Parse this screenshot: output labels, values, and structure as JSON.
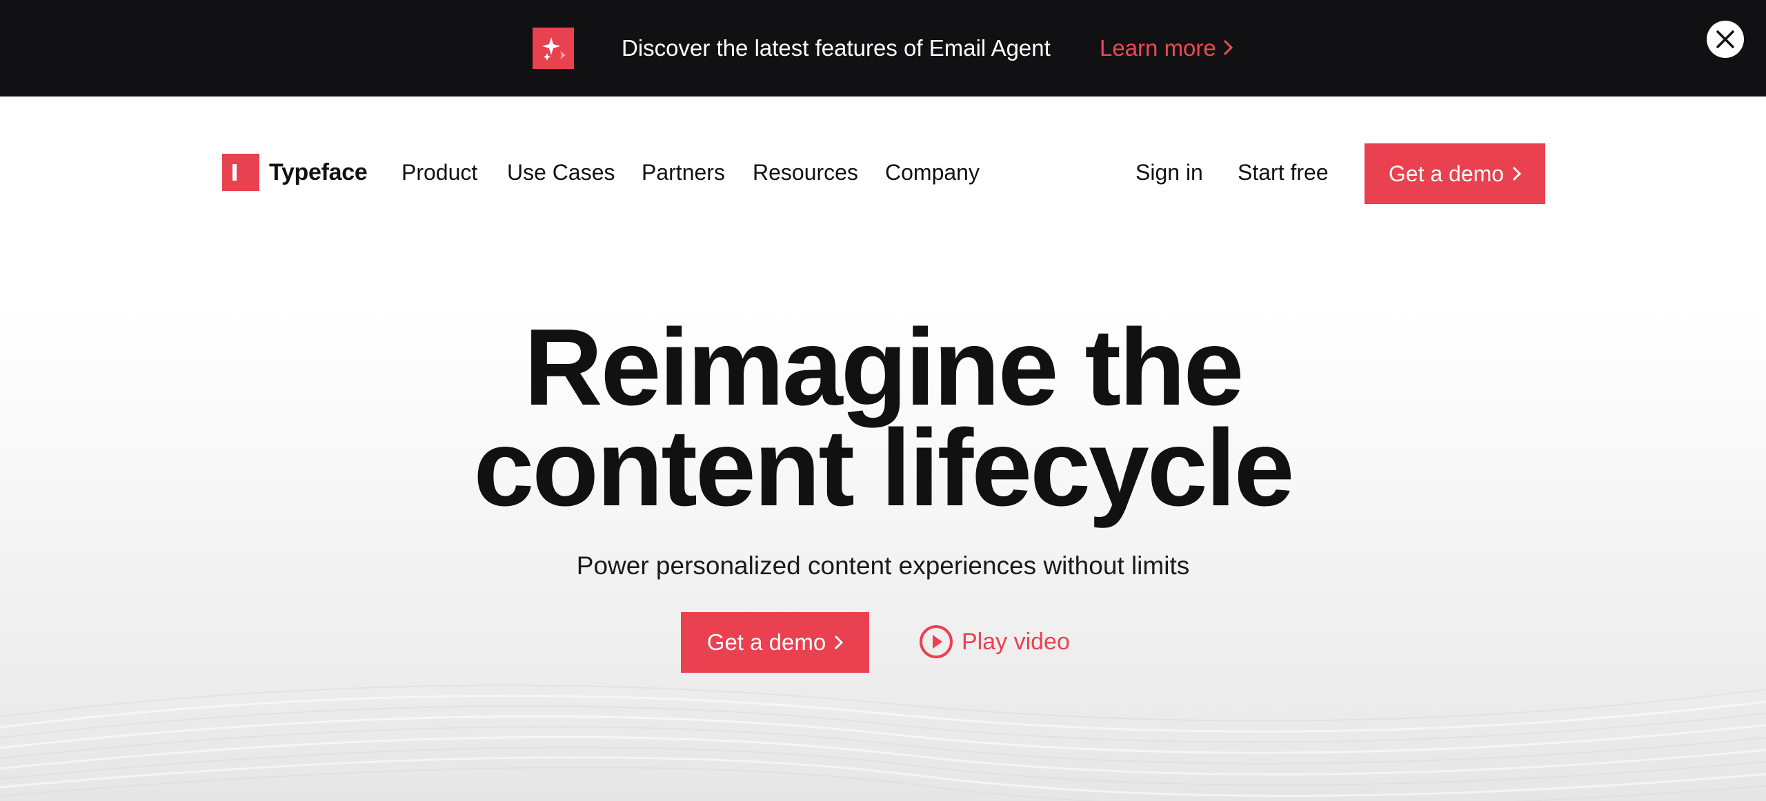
{
  "announcement": {
    "icon": "sparkle-icon",
    "text": "Discover the latest features of Email Agent",
    "link_label": "Learn more",
    "close_icon": "close-icon"
  },
  "nav": {
    "logo_text": "Typeface",
    "items": [
      {
        "label": "Product"
      },
      {
        "label": "Use Cases"
      },
      {
        "label": "Partners"
      },
      {
        "label": "Resources"
      },
      {
        "label": "Company"
      }
    ],
    "sign_in": "Sign in",
    "start_free": "Start free",
    "cta_label": "Get a demo"
  },
  "hero": {
    "title_line1": "Reimagine the",
    "title_line2": "content lifecycle",
    "subtitle": "Power personalized content experiences without limits",
    "cta_label": "Get a demo",
    "video_label": "Play video"
  },
  "colors": {
    "accent": "#e9414f",
    "announcement_bg": "#111113",
    "text": "#111111"
  }
}
